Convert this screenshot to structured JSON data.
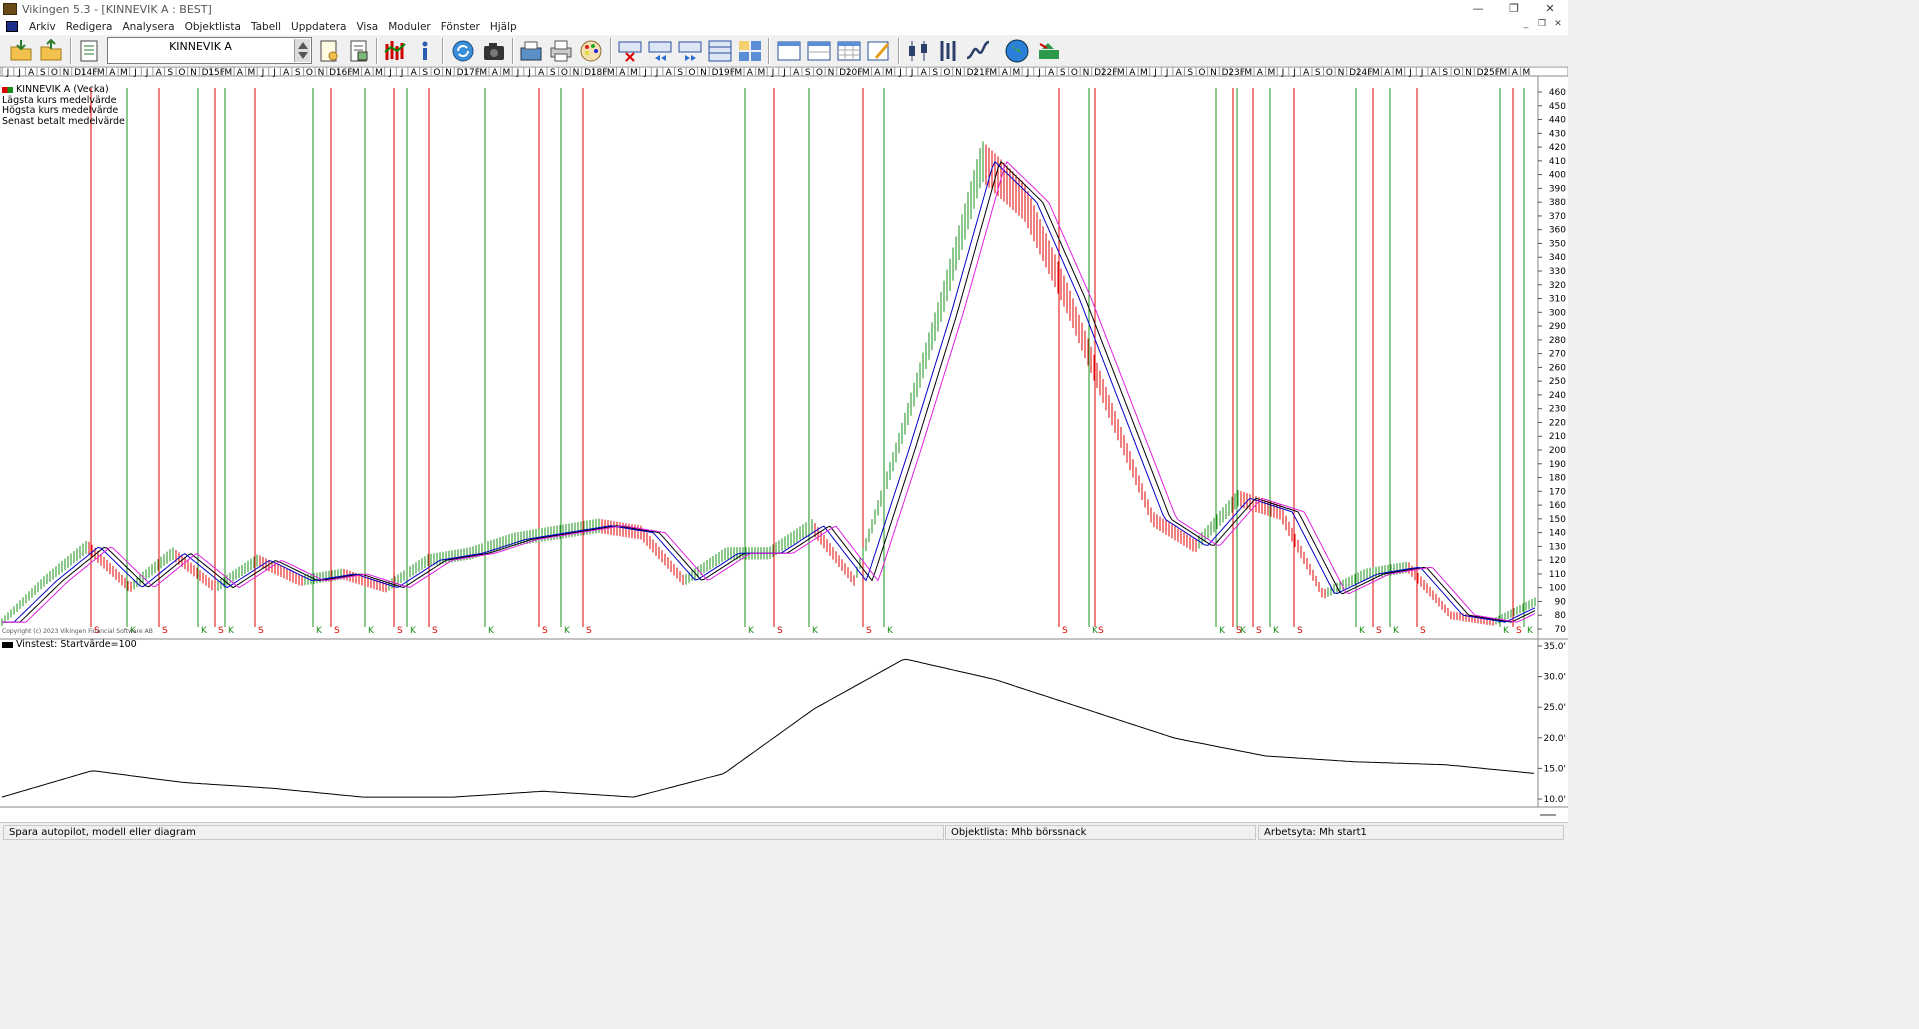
{
  "window": {
    "title": "Vikingen 5.3 - [KINNEVIK A : BEST]",
    "min": "—",
    "max": "❐",
    "close": "✕"
  },
  "menu": {
    "items": [
      "Arkiv",
      "Redigera",
      "Analysera",
      "Objektlista",
      "Tabell",
      "Uppdatera",
      "Visa",
      "Moduler",
      "Fönster",
      "Hjälp"
    ]
  },
  "toolbar": {
    "instrument": "KINNEVIK A"
  },
  "chart": {
    "legend": {
      "title": "KINNEVIK A (Vecka)",
      "lines": [
        "Lägsta kurs medelvärde",
        "Högsta kurs medelvärde",
        "Senast betalt medelvärde"
      ]
    },
    "copyright": "Copyright (c) 2023 Vikingen Financial Software AB",
    "months_row": "J J A S O N D 14F M A M J J A S O N D 15F M A M J J A S O N D 16F M A M J J A S O N D 17F M A M J J A S O N D 18F M A M J J A S O N D 19F M A M J J A S O N D 20F M A M J J A S O N D 21F M A M J J A S O N D 22F M A M J J A S O N D 23F M A M J J A S O N D 24F M A M J J A S O N D 25F M A M",
    "colors": {
      "up": "#1a8f1a",
      "down": "#e00000",
      "low_ma": "#e020e0",
      "high_ma": "#000000",
      "close_ma": "#0000cc"
    },
    "price_ticks": [
      460,
      450,
      440,
      430,
      420,
      410,
      400,
      390,
      380,
      370,
      360,
      350,
      340,
      330,
      320,
      310,
      300,
      290,
      280,
      270,
      260,
      250,
      240,
      230,
      220,
      210,
      200,
      190,
      180,
      170,
      160,
      150,
      140,
      130,
      120,
      110,
      100,
      90,
      80,
      70
    ],
    "signals": [
      {
        "x": 91,
        "t": "S"
      },
      {
        "x": 127,
        "t": "K"
      },
      {
        "x": 159,
        "t": "S"
      },
      {
        "x": 198,
        "t": "K"
      },
      {
        "x": 215,
        "t": "S"
      },
      {
        "x": 225,
        "t": "K"
      },
      {
        "x": 255,
        "t": "S"
      },
      {
        "x": 313,
        "t": "K"
      },
      {
        "x": 331,
        "t": "S"
      },
      {
        "x": 365,
        "t": "K"
      },
      {
        "x": 394,
        "t": "S"
      },
      {
        "x": 407,
        "t": "K"
      },
      {
        "x": 429,
        "t": "S"
      },
      {
        "x": 485,
        "t": "K"
      },
      {
        "x": 539,
        "t": "S"
      },
      {
        "x": 561,
        "t": "K"
      },
      {
        "x": 583,
        "t": "S"
      },
      {
        "x": 745,
        "t": "K"
      },
      {
        "x": 774,
        "t": "S"
      },
      {
        "x": 809,
        "t": "K"
      },
      {
        "x": 863,
        "t": "S"
      },
      {
        "x": 884,
        "t": "K"
      },
      {
        "x": 1059,
        "t": "S"
      },
      {
        "x": 1089,
        "t": "K"
      },
      {
        "x": 1095,
        "t": "S"
      },
      {
        "x": 1216,
        "t": "K"
      },
      {
        "x": 1233,
        "t": "S"
      },
      {
        "x": 1237,
        "t": "K"
      },
      {
        "x": 1253,
        "t": "S"
      },
      {
        "x": 1270,
        "t": "K"
      },
      {
        "x": 1294,
        "t": "S"
      },
      {
        "x": 1356,
        "t": "K"
      },
      {
        "x": 1373,
        "t": "S"
      },
      {
        "x": 1390,
        "t": "K"
      },
      {
        "x": 1417,
        "t": "S"
      },
      {
        "x": 1500,
        "t": "K"
      },
      {
        "x": 1513,
        "t": "S"
      },
      {
        "x": 1524,
        "t": "K"
      }
    ],
    "vinstest": {
      "label": "Vinstest: Startvärde=100",
      "ticks": [
        "35.0'",
        "30.0'",
        "25.0'",
        "20.0'",
        "15.0'",
        "10.0'"
      ]
    }
  },
  "chart_data": {
    "type": "line",
    "title": "KINNEVIK A (Vecka)",
    "ylim": [
      70,
      460
    ],
    "series": [
      {
        "name": "Senast betalt medelvärde",
        "values": [
          75,
          105,
          130,
          100,
          125,
          100,
          120,
          105,
          110,
          100,
          120,
          125,
          135,
          140,
          145,
          140,
          105,
          125,
          125,
          145,
          105,
          200,
          300,
          410,
          380,
          310,
          230,
          150,
          130,
          165,
          155,
          95,
          110,
          115,
          80,
          75,
          90
        ]
      },
      {
        "name": "Vinstest: Startvärde=100",
        "values": [
          100,
          145,
          125,
          115,
          100,
          100,
          110,
          100,
          140,
          250,
          335,
          300,
          250,
          200,
          170,
          160,
          155,
          140
        ]
      }
    ]
  },
  "status": {
    "left": "Spara autopilot, modell eller diagram",
    "mid": "Objektlista: Mhb börssnack",
    "right": "Arbetsyta: Mh start1"
  }
}
